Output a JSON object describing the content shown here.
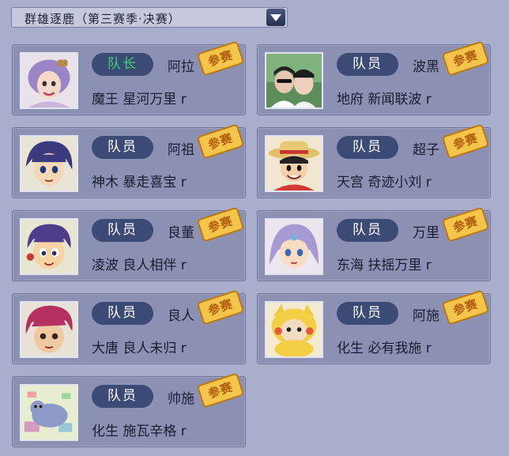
{
  "header": {
    "title": "群雄逐鹿（第三赛季·决赛）"
  },
  "stamp_label": "参赛",
  "members": [
    {
      "role": "队长",
      "nick": "阿拉",
      "server": "魔王  星河万里 r",
      "captain": true
    },
    {
      "role": "队员",
      "nick": "波黑",
      "server": "地府  新闻联波 r"
    },
    {
      "role": "队员",
      "nick": "阿祖",
      "server": "神木  暴走喜宝 r"
    },
    {
      "role": "队员",
      "nick": "超子",
      "server": "天宫  奇迹小刘 r"
    },
    {
      "role": "队员",
      "nick": "良董",
      "server": "凌波  良人相伴 r"
    },
    {
      "role": "队员",
      "nick": "万里",
      "server": "东海  扶摇万里 r"
    },
    {
      "role": "队员",
      "nick": "良人",
      "server": "大唐  良人未归 r"
    },
    {
      "role": "队员",
      "nick": "阿施",
      "server": "化生  必有我施 r"
    },
    {
      "role": "队员",
      "nick": "帅施",
      "server": "化生  施瓦辛格 r"
    }
  ]
}
